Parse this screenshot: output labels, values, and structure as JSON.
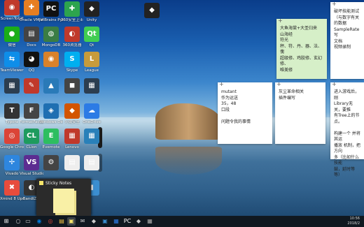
{
  "desktop_icons": [
    {
      "label": "",
      "glyph": "♻",
      "color": "#4aa3df"
    },
    {
      "label": "Oracle VM VirtualBox",
      "glyph": "▣",
      "color": "#1f5fa8"
    },
    {
      "label": "JetBrains PyCharm",
      "glyph": "PC",
      "color": "#111"
    },
    {
      "label": "360安全卫士",
      "glyph": "✚",
      "color": "#2da44e"
    },
    {
      "label": "Unity",
      "glyph": "◆",
      "color": "#222"
    },
    {
      "label": "微信",
      "glyph": "●",
      "color": "#1aad19"
    },
    {
      "label": "Docs",
      "glyph": "▤",
      "color": "#444"
    },
    {
      "label": "MongoDB",
      "glyph": "◍",
      "color": "#3a7d44"
    },
    {
      "label": "360浏览器",
      "glyph": "◐",
      "color": "#c0392b"
    },
    {
      "label": "Qt",
      "glyph": "Qt",
      "color": "#41cd52"
    },
    {
      "label": "TeamViewer",
      "glyph": "⇆",
      "color": "#0e8ee9"
    },
    {
      "label": "QQ",
      "glyph": "◕",
      "color": "#111"
    },
    {
      "label": "",
      "glyph": "◉",
      "color": "#d9822b"
    },
    {
      "label": "Skype",
      "glyph": "S",
      "color": "#00aff0"
    },
    {
      "label": "League",
      "glyph": "L",
      "color": "#c79b3b"
    },
    {
      "label": "",
      "glyph": "▦",
      "color": "#2c3e50"
    },
    {
      "label": "",
      "glyph": "✎",
      "color": "#c0392b"
    },
    {
      "label": "",
      "glyph": "▲",
      "color": "#2a7ab8"
    },
    {
      "label": "",
      "glyph": "◼",
      "color": "#444"
    },
    {
      "label": "",
      "glyph": "▦",
      "color": "#2c3e50"
    },
    {
      "label": "Typora",
      "glyph": "T",
      "color": "#333"
    },
    {
      "label": "FormatFactory",
      "glyph": "F",
      "color": "#444"
    },
    {
      "label": "Windows Defender",
      "glyph": "◈",
      "color": "#1f6fb2"
    },
    {
      "label": "火绒安全",
      "glyph": "◆",
      "color": "#d35400"
    },
    {
      "label": "OneDrive",
      "glyph": "☁",
      "color": "#2c7be5"
    },
    {
      "label": "Google Chrome",
      "glyph": "◎",
      "color": "#db4437"
    },
    {
      "label": "CLion",
      "glyph": "CL",
      "color": "#1e9b5e"
    },
    {
      "label": "Evernote",
      "glyph": "E",
      "color": "#2dbe60"
    },
    {
      "label": "Lenovo",
      "glyph": "▦",
      "color": "#c0392b"
    },
    {
      "label": "",
      "glyph": "▦",
      "color": "#2980b9"
    },
    {
      "label": "Vivado",
      "glyph": "✢",
      "color": "#2e86de"
    },
    {
      "label": "Visual Studio",
      "glyph": "VS",
      "color": "#5c2d91"
    },
    {
      "label": "",
      "glyph": "⚙",
      "color": "#444"
    },
    {
      "label": "",
      "glyph": "▤",
      "color": "#eee"
    },
    {
      "label": "",
      "glyph": "▤",
      "color": "#eee"
    },
    {
      "label": "Xmind 8 Update 2",
      "glyph": "✖",
      "color": "#e74c3c"
    },
    {
      "label": "BandiZip",
      "glyph": "◐",
      "color": "#333"
    },
    {
      "label": "Maya 2016",
      "glyph": "M",
      "color": "#1aa3a3"
    },
    {
      "label": "Wizard",
      "glyph": "▤",
      "color": "#eee"
    },
    {
      "label": "",
      "glyph": "▮",
      "color": "#3b8ed0"
    },
    {
      "label": "ScreenToGif",
      "glyph": "◉",
      "color": "#c0392b"
    },
    {
      "label": "",
      "glyph": "✚",
      "color": "#e67e22"
    }
  ],
  "top_icon": {
    "label": "",
    "glyph": "◆"
  },
  "notes": [
    {
      "text": "大鱼海棠+大圣归来\n山海经\n符光\n秤、符、丹、器、法、傀\n超级修、鸡胶修、玄幻修、\n唯美修",
      "bg": "#d6efc8"
    },
    {
      "text": "破坏技能测试\n（与数字有关的数据\nSampleRate写\n文档\n视频录制",
      "bg": "#ffffff"
    },
    {
      "text": "mutant\n作为运送\n35，48\n口段\n\n问题令我的事情",
      "bg": "#ffffff"
    },
    {
      "text": "灰尘革命相关\n插件编写",
      "bg": "#ffffff"
    },
    {
      "text": "进入游戏后，刚\nLibrary无关，要推\n有Tree上的节点。\n\n构建一个 并将其运\n播放 机制，把方向\n多（比如什么技能\n鼓，延时等等）",
      "bg": "#ffffff"
    }
  ],
  "popup": {
    "title": "Sticky Notes"
  },
  "taskbar": {
    "items": [
      {
        "glyph": "⊞",
        "color": "#fff"
      },
      {
        "glyph": "○",
        "color": "#ccc"
      },
      {
        "glyph": "▭",
        "color": "#ccc"
      },
      {
        "glyph": "◉",
        "color": "#0078d7"
      },
      {
        "glyph": "◎",
        "color": "#db4437"
      },
      {
        "glyph": "▤",
        "color": "#f5c542"
      },
      {
        "glyph": "▣",
        "color": "#f5e56b"
      },
      {
        "glyph": "✉",
        "color": "#ccc"
      },
      {
        "glyph": "◆",
        "color": "#ccc"
      },
      {
        "glyph": "▣",
        "color": "#3b8ed0"
      },
      {
        "glyph": "▦",
        "color": "#2c7be5"
      },
      {
        "glyph": "PC",
        "color": "#fff"
      },
      {
        "glyph": "◆",
        "color": "#ccc"
      },
      {
        "glyph": "▦",
        "color": "#aaa"
      }
    ],
    "time": "10:56",
    "date": "2018/2"
  }
}
